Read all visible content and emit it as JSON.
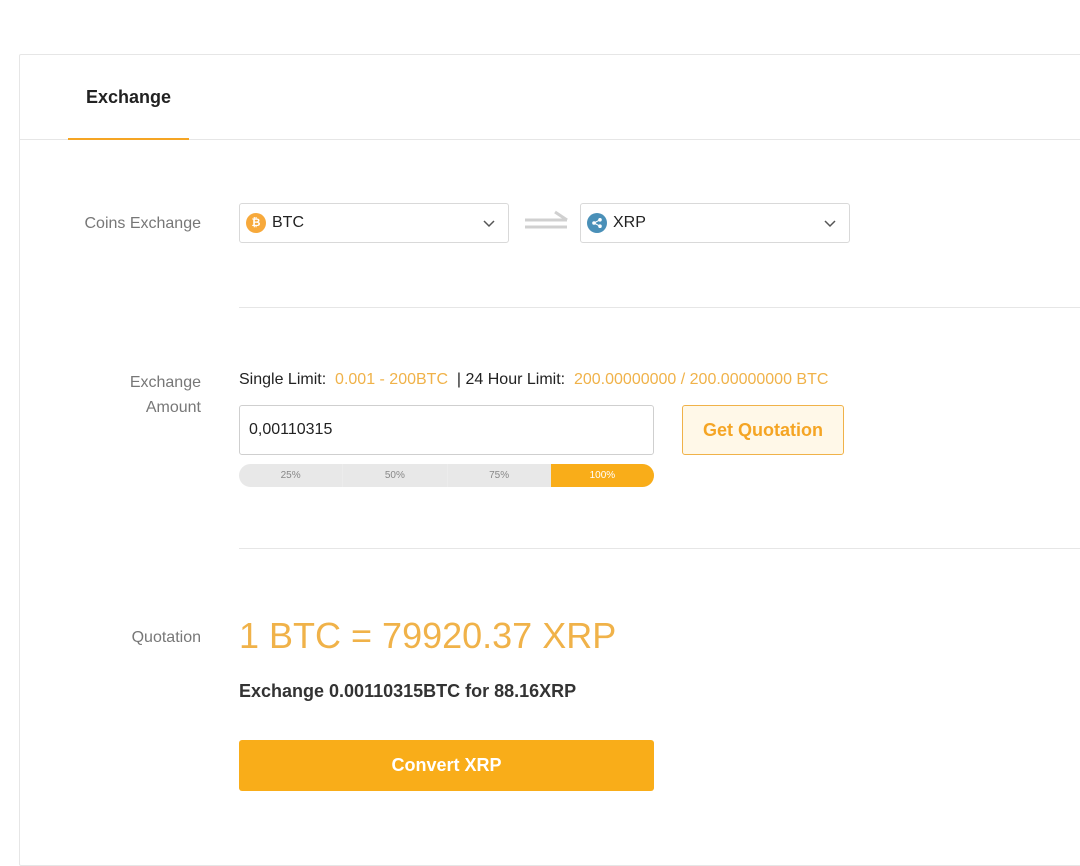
{
  "tabs": [
    {
      "label": "Exchange",
      "active": true
    }
  ],
  "coins_exchange": {
    "label": "Coins Exchange",
    "from": {
      "symbol": "BTC",
      "icon": "bitcoin-icon",
      "color": "#f7a93b"
    },
    "to": {
      "symbol": "XRP",
      "icon": "xrp-icon",
      "color": "#4a90b8"
    }
  },
  "exchange_amount": {
    "label": "Exchange Amount",
    "single_limit_label": "Single Limit:",
    "single_limit_value": "0.001 - 200BTC",
    "daily_limit_label": "| 24 Hour Limit:",
    "daily_limit_value": "200.00000000 / 200.00000000 BTC",
    "input_value": "0,00110315",
    "quote_button": "Get Quotation",
    "percent_options": [
      "25%",
      "50%",
      "75%",
      "100%"
    ],
    "selected_percent": "100%"
  },
  "quotation": {
    "label": "Quotation",
    "rate": "1 BTC = 79920.37 XRP",
    "summary": "Exchange 0.00110315BTC for 88.16XRP",
    "convert_button": "Convert XRP"
  },
  "colors": {
    "accent": "#f9ad19",
    "accent_text": "#f0b249",
    "tab_underline": "#f5a524"
  }
}
